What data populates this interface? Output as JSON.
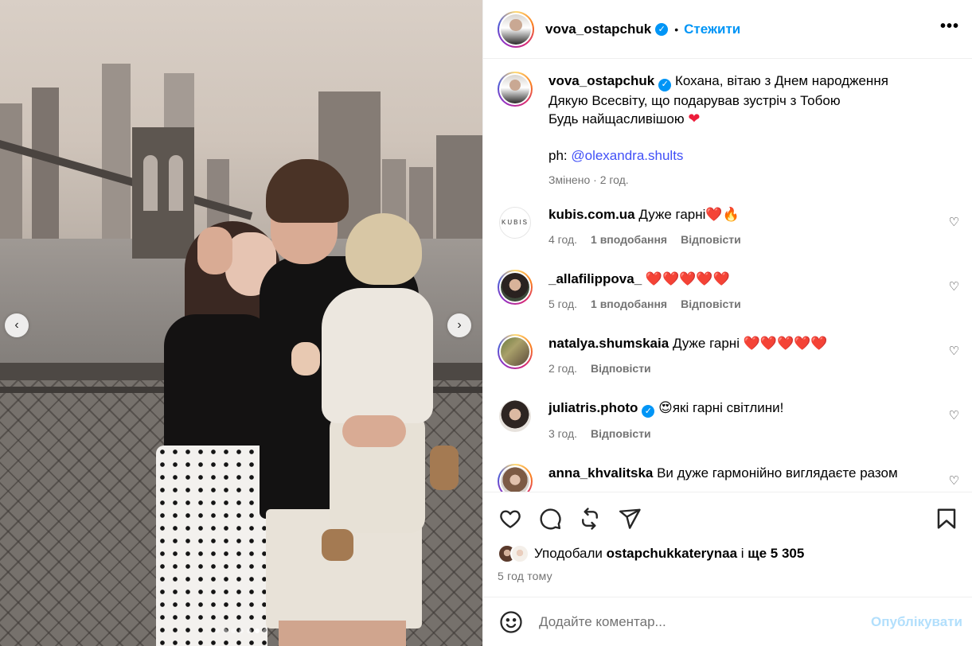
{
  "post": {
    "author": "vova_ostapchuk",
    "follow_label": "Стежити",
    "bullet": "•",
    "more_label": "•••"
  },
  "carousel": {
    "prev_label": "‹",
    "next_label": "›",
    "dot_count": 7,
    "active_dot": 5
  },
  "caption": {
    "lines": [
      "Кохана, вітаю з Днем народження",
      "Дякую Всесвіту, що подарував зустріч з Тобою",
      "Будь найщасливішою"
    ],
    "photographer_prefix": "ph: ",
    "photographer_link": "@olexandra.shults",
    "edited": "Змінено",
    "edited_sep": " · ",
    "edited_time": "2 год."
  },
  "comments": [
    {
      "user": "kubis.com.ua",
      "text": "Дуже гарні❤️🔥",
      "time": "4 год.",
      "likes": "1 вподобання",
      "reply": "Відповісти",
      "avatar_text": "KUBIS"
    },
    {
      "user": "_allafilippova_",
      "text": "❤️❤️❤️❤️❤️",
      "time": "5 год.",
      "likes": "1 вподобання",
      "reply": "Відповісти"
    },
    {
      "user": "natalya.shumskaia",
      "text": "Дуже гарні ❤️❤️❤️❤️❤️",
      "time": "2 год.",
      "likes": "",
      "reply": "Відповісти"
    },
    {
      "user": "juliatris.photo",
      "text": "😍які гарні світлини!",
      "time": "3 год.",
      "likes": "",
      "reply": "Відповісти"
    },
    {
      "user": "anna_khvalitska",
      "text": "Ви дуже гармонійно виглядаєте разом",
      "time": "",
      "likes": "",
      "reply": ""
    }
  ],
  "likes": {
    "prefix": "Уподобали ",
    "first_user": "ostapchukkaterynaa",
    "middle": " і ",
    "rest": "ще 5 305"
  },
  "time_ago": "5 год тому",
  "composer": {
    "placeholder": "Додайте коментар...",
    "publish_label": "Опублікувати"
  },
  "colors": {
    "accent": "#0095f6",
    "heart": "#ed1c3a",
    "muted": "#737373"
  }
}
